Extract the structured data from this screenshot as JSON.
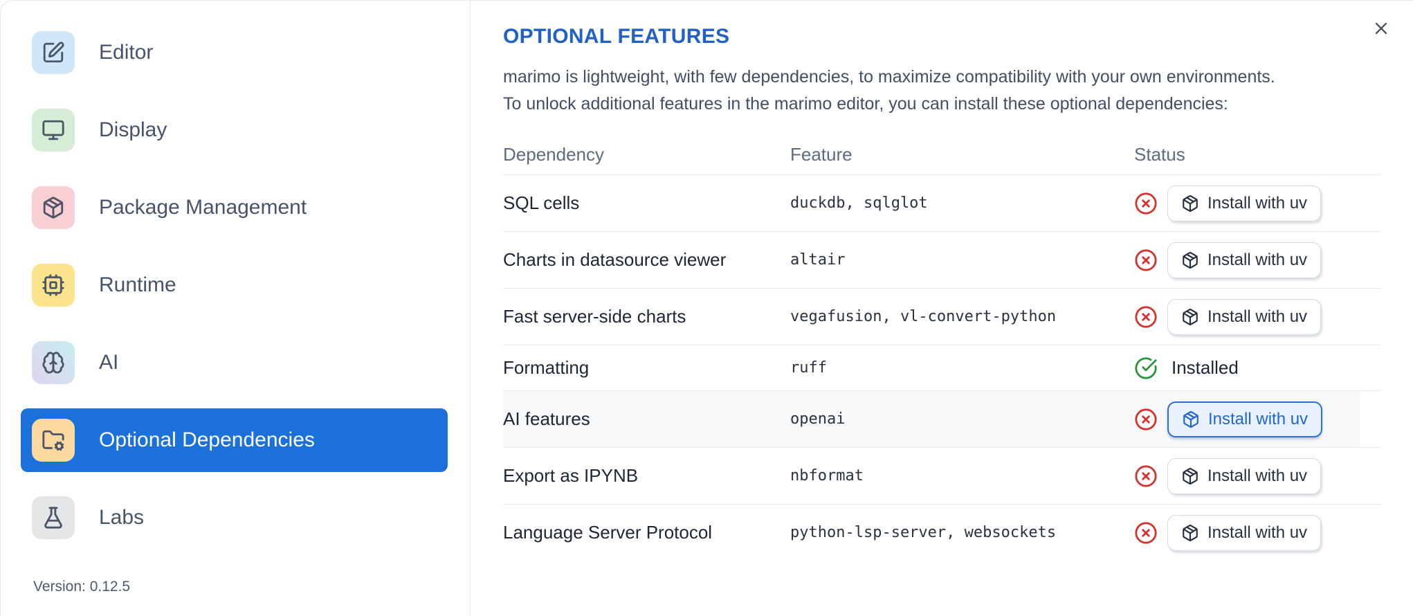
{
  "sidebar": {
    "items": [
      {
        "label": "Editor",
        "icon": "square-pen-icon",
        "icon_bg": "#cfe7f8",
        "active": false
      },
      {
        "label": "Display",
        "icon": "monitor-icon",
        "icon_bg": "#d5ecd5",
        "active": false
      },
      {
        "label": "Package Management",
        "icon": "package-icon",
        "icon_bg": "#f9cfd3",
        "active": false
      },
      {
        "label": "Runtime",
        "icon": "cpu-icon",
        "icon_bg": "#fbe48d",
        "active": false
      },
      {
        "label": "AI",
        "icon": "brain-icon",
        "icon_bg": "#c7edef",
        "icon_bg_to": "#e0d3f0",
        "active": false
      },
      {
        "label": "Optional Dependencies",
        "icon": "folder-cog-icon",
        "icon_bg": "#fbd9a0",
        "active": true
      },
      {
        "label": "Labs",
        "icon": "flask-icon",
        "icon_bg": "#e5e6e8",
        "active": false
      }
    ],
    "version_label": "Version: 0.12.5"
  },
  "panel": {
    "title": "OPTIONAL FEATURES",
    "description_lines": [
      "marimo is lightweight, with few dependencies, to maximize compatibility with your own environments.",
      "To unlock additional features in the marimo editor, you can install these optional dependencies:"
    ],
    "close_icon": "x-icon"
  },
  "table": {
    "headers": [
      "Dependency",
      "Feature",
      "Status"
    ],
    "rows": [
      {
        "dependency": "SQL cells",
        "feature": "duckdb, sqlglot",
        "status": "missing",
        "action_label": "Install with uv",
        "highlighted": false
      },
      {
        "dependency": "Charts in datasource viewer",
        "feature": "altair",
        "status": "missing",
        "action_label": "Install with uv",
        "highlighted": false
      },
      {
        "dependency": "Fast server-side charts",
        "feature": "vegafusion, vl-convert-python",
        "status": "missing",
        "action_label": "Install with uv",
        "highlighted": false
      },
      {
        "dependency": "Formatting",
        "feature": "ruff",
        "status": "installed",
        "status_label": "Installed"
      },
      {
        "dependency": "AI features",
        "feature": "openai",
        "status": "missing",
        "action_label": "Install with uv",
        "highlighted": true
      },
      {
        "dependency": "Export as IPYNB",
        "feature": "nbformat",
        "status": "missing",
        "action_label": "Install with uv",
        "highlighted": false
      },
      {
        "dependency": "Language Server Protocol",
        "feature": "python-lsp-server, websockets",
        "status": "missing",
        "action_label": "Install with uv",
        "highlighted": false
      }
    ]
  },
  "colors": {
    "accent_blue": "#1c70d9",
    "title_blue": "#2161c6",
    "status_missing_red": "#d3342f",
    "status_installed_green": "#2b9440",
    "highlight_button_blue": "#2166cc",
    "row_highlight_bg": "#f7f8fa",
    "divider": "#e5e8ec"
  }
}
